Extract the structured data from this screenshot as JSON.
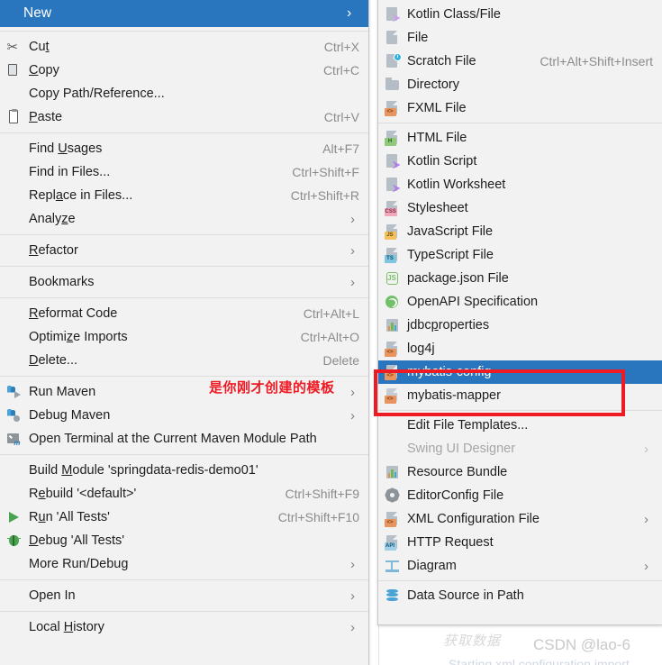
{
  "context_menu": {
    "header": {
      "label": "New",
      "arrow": "›"
    },
    "groups": [
      [
        {
          "name": "cut",
          "label": "Cut",
          "mnemonic": "t",
          "shortcut": "Ctrl+X",
          "icon": "scissors-icon"
        },
        {
          "name": "copy",
          "label": "Copy",
          "mnemonic": "C",
          "shortcut": "Ctrl+C",
          "icon": "copy-icon"
        },
        {
          "name": "copy-path-reference",
          "label": "Copy Path/Reference...",
          "shortcut": "",
          "icon": ""
        },
        {
          "name": "paste",
          "label": "Paste",
          "mnemonic": "P",
          "shortcut": "Ctrl+V",
          "icon": "paste-icon"
        }
      ],
      [
        {
          "name": "find-usages",
          "label": "Find Usages",
          "mnemonic": "U",
          "shortcut": "Alt+F7",
          "icon": ""
        },
        {
          "name": "find-in-files",
          "label": "Find in Files...",
          "shortcut": "Ctrl+Shift+F",
          "icon": ""
        },
        {
          "name": "replace-in-files",
          "label": "Replace in Files...",
          "mnemonic": "a",
          "shortcut": "Ctrl+Shift+R",
          "icon": ""
        },
        {
          "name": "analyze",
          "label": "Analyze",
          "mnemonic": "z",
          "shortcut": "",
          "submenu": true,
          "icon": ""
        }
      ],
      [
        {
          "name": "refactor",
          "label": "Refactor",
          "mnemonic": "R",
          "shortcut": "",
          "submenu": true,
          "icon": ""
        }
      ],
      [
        {
          "name": "bookmarks",
          "label": "Bookmarks",
          "shortcut": "",
          "submenu": true,
          "icon": ""
        }
      ],
      [
        {
          "name": "reformat-code",
          "label": "Reformat Code",
          "mnemonic": "R",
          "shortcut": "Ctrl+Alt+L",
          "icon": ""
        },
        {
          "name": "optimize-imports",
          "label": "Optimize Imports",
          "mnemonic": "z",
          "shortcut": "Ctrl+Alt+O",
          "icon": ""
        },
        {
          "name": "delete",
          "label": "Delete...",
          "mnemonic": "D",
          "shortcut": "Delete",
          "icon": ""
        }
      ],
      [
        {
          "name": "run-maven",
          "label": "Run Maven",
          "shortcut": "",
          "submenu": true,
          "icon": "maven-run-icon"
        },
        {
          "name": "debug-maven",
          "label": "Debug Maven",
          "shortcut": "",
          "submenu": true,
          "icon": "maven-debug-icon"
        },
        {
          "name": "open-terminal-maven-module",
          "label": "Open Terminal at the Current Maven Module Path",
          "shortcut": "",
          "icon": "maven-terminal-icon"
        }
      ],
      [
        {
          "name": "build-module",
          "label": "Build Module 'springdata-redis-demo01'",
          "mnemonic": "M",
          "shortcut": "",
          "icon": ""
        },
        {
          "name": "rebuild-default",
          "label": "Rebuild '<default>'",
          "mnemonic": "e",
          "shortcut": "Ctrl+Shift+F9",
          "icon": ""
        },
        {
          "name": "run-all-tests",
          "label": "Run 'All Tests'",
          "mnemonic": "u",
          "shortcut": "Ctrl+Shift+F10",
          "icon": "run-icon"
        },
        {
          "name": "debug-all-tests",
          "label": "Debug 'All Tests'",
          "mnemonic": "D",
          "shortcut": "",
          "icon": "debug-icon"
        },
        {
          "name": "more-run-debug",
          "label": "More Run/Debug",
          "shortcut": "",
          "submenu": true,
          "icon": ""
        }
      ],
      [
        {
          "name": "open-in",
          "label": "Open In",
          "shortcut": "",
          "submenu": true,
          "icon": ""
        }
      ],
      [
        {
          "name": "local-history",
          "label": "Local History",
          "mnemonic": "H",
          "shortcut": "",
          "submenu": true,
          "icon": ""
        }
      ]
    ]
  },
  "new_submenu": {
    "groups": [
      [
        {
          "name": "kotlin-class-file",
          "label": "Kotlin Class/File",
          "shortcut": "",
          "icon": "kotlin-file-icon"
        },
        {
          "name": "file",
          "label": "File",
          "shortcut": "",
          "icon": "file-icon"
        },
        {
          "name": "scratch-file",
          "label": "Scratch File",
          "shortcut": "Ctrl+Alt+Shift+Insert",
          "icon": "scratch-file-icon"
        },
        {
          "name": "directory",
          "label": "Directory",
          "shortcut": "",
          "icon": "folder-icon"
        },
        {
          "name": "fxml-file",
          "label": "FXML File",
          "shortcut": "",
          "icon": "xml-file-icon"
        }
      ],
      [
        {
          "name": "html-file",
          "label": "HTML File",
          "shortcut": "",
          "icon": "html-file-icon"
        },
        {
          "name": "kotlin-script",
          "label": "Kotlin Script",
          "shortcut": "",
          "icon": "kotlin-file-icon"
        },
        {
          "name": "kotlin-worksheet",
          "label": "Kotlin Worksheet",
          "shortcut": "",
          "icon": "kotlin-file-icon"
        },
        {
          "name": "stylesheet",
          "label": "Stylesheet",
          "shortcut": "",
          "icon": "css-file-icon"
        },
        {
          "name": "javascript-file",
          "label": "JavaScript File",
          "shortcut": "",
          "icon": "js-file-icon"
        },
        {
          "name": "typescript-file",
          "label": "TypeScript File",
          "shortcut": "",
          "icon": "ts-file-icon"
        },
        {
          "name": "package-json-file",
          "label": "package.json File",
          "shortcut": "",
          "icon": "node-icon"
        },
        {
          "name": "openapi-specification",
          "label": "OpenAPI Specification",
          "shortcut": "",
          "icon": "openapi-icon"
        },
        {
          "name": "jdbcproperties",
          "label": "jdbcproperties",
          "mnemonic": "p",
          "shortcut": "",
          "icon": "properties-icon"
        },
        {
          "name": "log4j",
          "label": "log4j",
          "shortcut": "",
          "icon": "xml-file-icon"
        },
        {
          "name": "mybatis-config",
          "label": "mybatis-config",
          "shortcut": "",
          "icon": "xml-file-icon",
          "selected": true
        },
        {
          "name": "mybatis-mapper",
          "label": "mybatis-mapper",
          "shortcut": "",
          "icon": "xml-file-icon"
        }
      ],
      [
        {
          "name": "edit-file-templates",
          "label": "Edit File Templates...",
          "shortcut": "",
          "icon": ""
        },
        {
          "name": "swing-ui-designer",
          "label": "Swing UI Designer",
          "shortcut": "",
          "submenu": true,
          "disabled": true,
          "icon": ""
        },
        {
          "name": "resource-bundle",
          "label": "Resource Bundle",
          "shortcut": "",
          "icon": "properties-icon"
        },
        {
          "name": "editorconfig-file",
          "label": "EditorConfig File",
          "shortcut": "",
          "icon": "gear-icon"
        },
        {
          "name": "xml-configuration-file",
          "label": "XML Configuration File",
          "shortcut": "",
          "submenu": true,
          "icon": "xml-file-icon"
        },
        {
          "name": "http-request",
          "label": "HTTP Request",
          "shortcut": "",
          "icon": "api-file-icon"
        },
        {
          "name": "diagram",
          "label": "Diagram",
          "shortcut": "",
          "submenu": true,
          "icon": "diagram-icon"
        }
      ],
      [
        {
          "name": "data-source-in-path",
          "label": "Data Source in Path",
          "shortcut": "",
          "icon": "datasource-icon"
        }
      ]
    ]
  },
  "annotations": {
    "red_note": "是你刚才创建的模板",
    "red_box_target": "mybatis-config / mybatis-mapper",
    "colors": {
      "highlight": "#2a76be",
      "annotation": "#ef1b24",
      "menu_bg": "#f2f2f2"
    }
  },
  "watermark": {
    "chinese": "获取数据",
    "csdn": "CSDN @lao-6"
  }
}
